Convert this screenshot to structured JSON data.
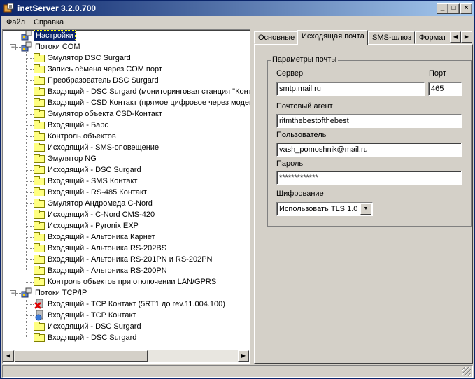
{
  "window": {
    "title": "inetServer 3.2.0.700",
    "controls": [
      "minimize-icon",
      "maximize-icon",
      "close-icon"
    ]
  },
  "menu": [
    "Файл",
    "Справка"
  ],
  "tree": {
    "settings": "Настройки",
    "com_group": "Потоки COM",
    "com_items": [
      "Эмулятор DSC Surgard",
      "Запись обмена через COM порт",
      "Преобразователь DSC Surgard",
      "Входящий - DSC Surgard (мониторинговая станция \"Конт",
      "Входящий - CSD Контакт (прямое цифровое через модем",
      "Эмулятор объекта CSD-Контакт",
      "Входящий - Барс",
      "Контроль объектов",
      "Исходящий - SMS-оповещение",
      "Эмулятор NG",
      "Исходящий - DSC Surgard",
      "Входящий - SMS Контакт",
      "Входящий - RS-485 Контакт",
      "Эмулятор Андромеда C-Nord",
      "Исходящий - C-Nord CMS-420",
      "Исходящий - Pyronix EXP",
      "Входящий - Альтоника Карнет",
      "Входящий - Альтоника RS-202BS",
      "Входящий - Альтоника RS-201PN и RS-202PN",
      "Входящий - Альтоника RS-200PN",
      "Контроль объектов при отключении LAN/GPRS"
    ],
    "tcp_group": "Потоки TCP/IP",
    "tcp_items": [
      {
        "label": "Входящий - TCP Контакт (5RT1 до rev.11.004.100)",
        "icon": "error-x-icon"
      },
      {
        "label": "Входящий - TCP Контакт",
        "icon": "network-icon"
      },
      {
        "label": "Исходящий - DSC Surgard",
        "icon": "folder-icon"
      },
      {
        "label": "Входящий - DSC Surgard",
        "icon": "folder-icon"
      }
    ]
  },
  "tabs": [
    "Основные",
    "Исходящая почта",
    "SMS-шлюз",
    "Формат"
  ],
  "active_tab": "Исходящая почта",
  "mail": {
    "group_title": "Параметры почты",
    "server_label": "Сервер",
    "server_value": "smtp.mail.ru",
    "port_label": "Порт",
    "port_value": "465",
    "agent_label": "Почтовый агент",
    "agent_value": "ritmthebestofthebest",
    "user_label": "Пользователь",
    "user_value": "vash_pomoshnik@mail.ru",
    "password_label": "Пароль",
    "password_value": "*************",
    "encryption_label": "Шифрование",
    "encryption_value": "Использовать TLS 1.0"
  },
  "colors": {
    "title_active": "#0a246a",
    "face": "#d4d0c8",
    "folder": "#ffff80"
  }
}
